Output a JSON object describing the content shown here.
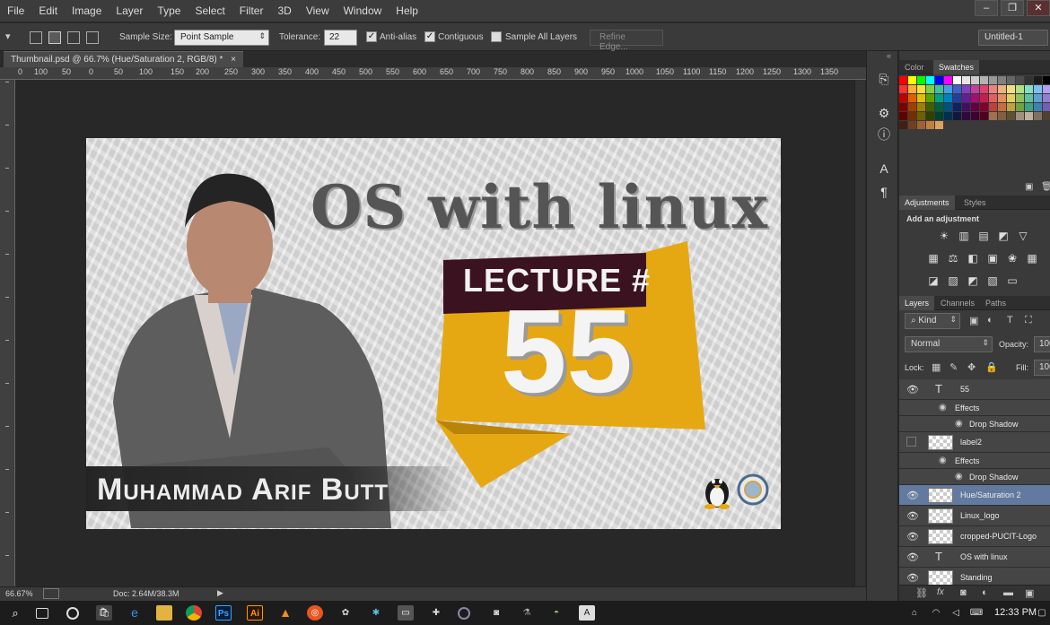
{
  "menu": [
    "File",
    "Edit",
    "Image",
    "Layer",
    "Type",
    "Select",
    "Filter",
    "3D",
    "View",
    "Window",
    "Help"
  ],
  "options": {
    "sample_size_label": "Sample Size:",
    "sample_size_value": "Point Sample",
    "tolerance_label": "Tolerance:",
    "tolerance_value": "22",
    "antialias_label": "Anti-alias",
    "contiguous_label": "Contiguous",
    "sample_all_label": "Sample All Layers",
    "refine_edge_label": "Refine Edge...",
    "workspace_value": "Untitled-1"
  },
  "document": {
    "tab_title": "Thumbnail.psd @ 66.7% (Hue/Saturation 2, RGB/8) *",
    "close_glyph": "×",
    "ruler_h": [
      "0",
      "100",
      "50",
      "0",
      "50",
      "100",
      "150",
      "200",
      "250",
      "300",
      "350",
      "400",
      "450",
      "500",
      "550",
      "600",
      "650",
      "700",
      "750",
      "800",
      "850",
      "900",
      "950",
      "1000",
      "1050",
      "1100",
      "1150",
      "1200",
      "1250",
      "1300",
      "1350"
    ],
    "zoom": "66.67%",
    "doc_info": "Doc: 2.64M/38.3M"
  },
  "artwork": {
    "title": "OS with linux",
    "lecture_label": "LECTURE #",
    "lecture_number": "55",
    "presenter": "Muhammad Arif Butt",
    "colors": {
      "banner": "#e6a812",
      "band": "#3b1220"
    }
  },
  "panels": {
    "color_tabs": [
      "Color",
      "Swatches"
    ],
    "adjust_tabs": [
      "Adjustments",
      "Styles"
    ],
    "add_adjustment": "Add an adjustment",
    "layers_tabs": [
      "Layers",
      "Channels",
      "Paths"
    ],
    "kind_label": "Kind",
    "blend_mode": "Normal",
    "opacity_label": "Opacity:",
    "opacity_value": "100",
    "lock_label": "Lock:",
    "fill_label": "Fill:",
    "fill_value": "100"
  },
  "layers": {
    "l55": "55",
    "effects1": "Effects",
    "drop1": "Drop Shadow",
    "label2": "label2",
    "effects2": "Effects",
    "drop2": "Drop Shadow",
    "hue": "Hue/Saturation 2",
    "linux": "Linux_logo",
    "pucit": "cropped-PUCIT-Logo",
    "os": "OS with linux",
    "standing": "Standing"
  },
  "taskbar": {
    "time": "12:33 PM"
  },
  "icons": [
    "search-icon",
    "task-view-icon",
    "chrome-icon",
    "store-icon",
    "edge-icon",
    "explorer-icon",
    "photoshop-icon",
    "illustrator-icon",
    "vlc-icon",
    "ubuntu-icon",
    "gear-icon",
    "eye-icon",
    "text-layer-icon",
    "link-icon",
    "fx-icon",
    "lock-icon"
  ]
}
